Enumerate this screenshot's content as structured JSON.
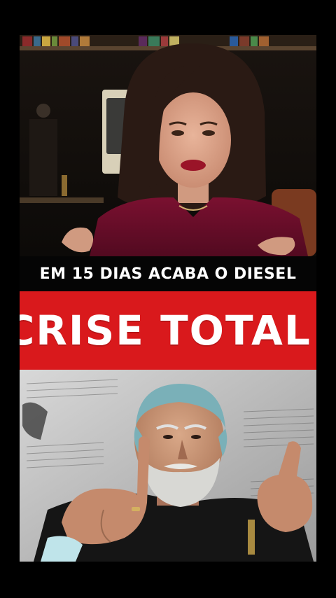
{
  "headline": "EM 15 DIAS ACABA O DIESEL",
  "banner": "CRISE TOTAL!",
  "colors": {
    "banner_red": "#d9191c",
    "headline_text": "#ffffff",
    "background": "#000000"
  }
}
